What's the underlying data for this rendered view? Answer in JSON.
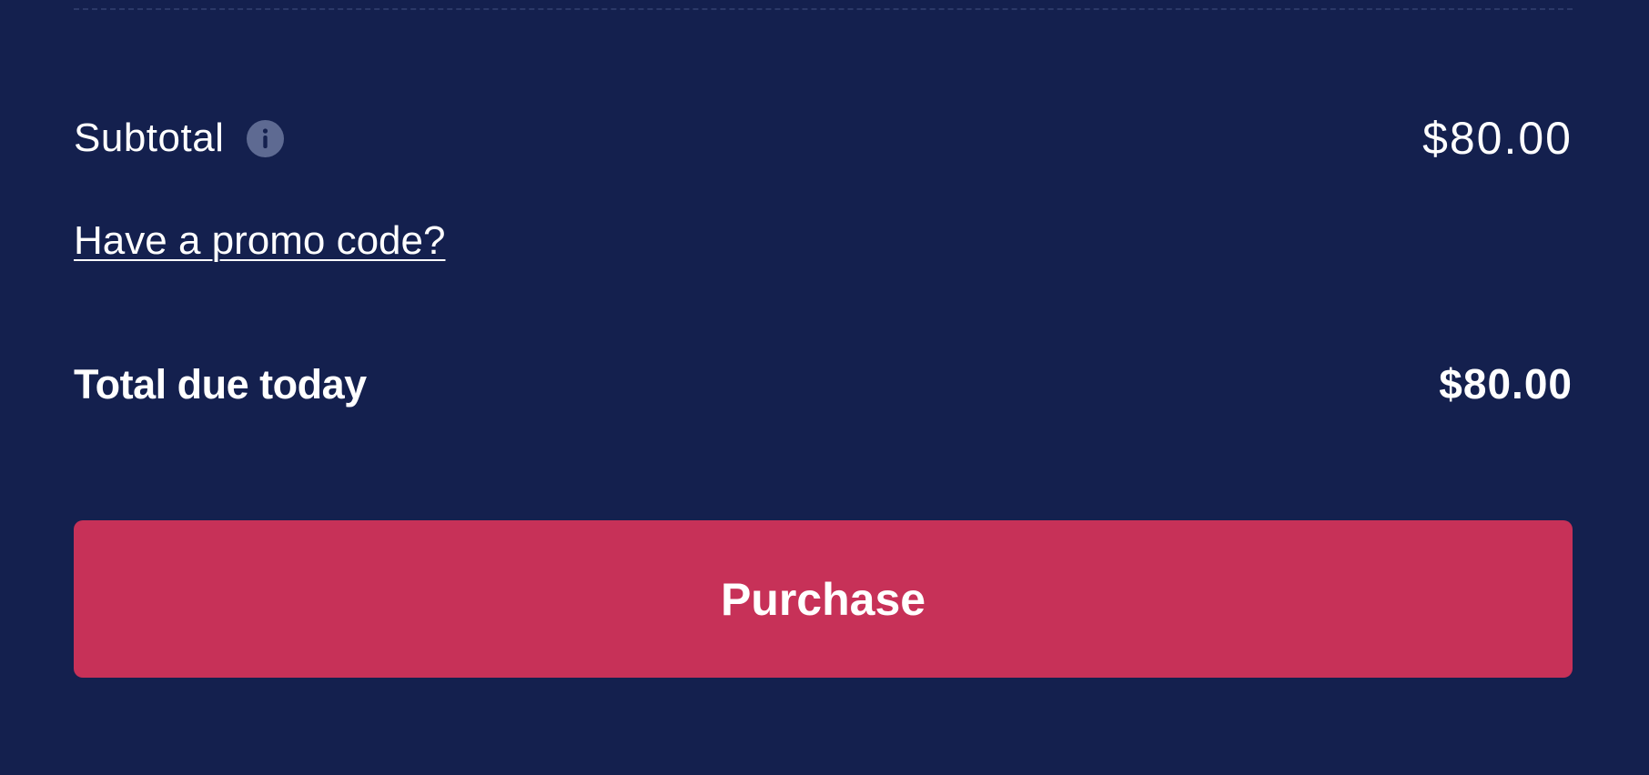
{
  "summary": {
    "subtotal_label": "Subtotal",
    "subtotal_value": "$80.00",
    "info_icon": "info-icon",
    "promo_link": "Have a promo code?",
    "total_label": "Total due today",
    "total_value": "$80.00"
  },
  "actions": {
    "purchase_label": "Purchase"
  },
  "colors": {
    "background": "#14204e",
    "accent": "#c73158",
    "info_icon_bg": "#5e6a92",
    "divider": "#2c3968",
    "text": "#ffffff"
  }
}
